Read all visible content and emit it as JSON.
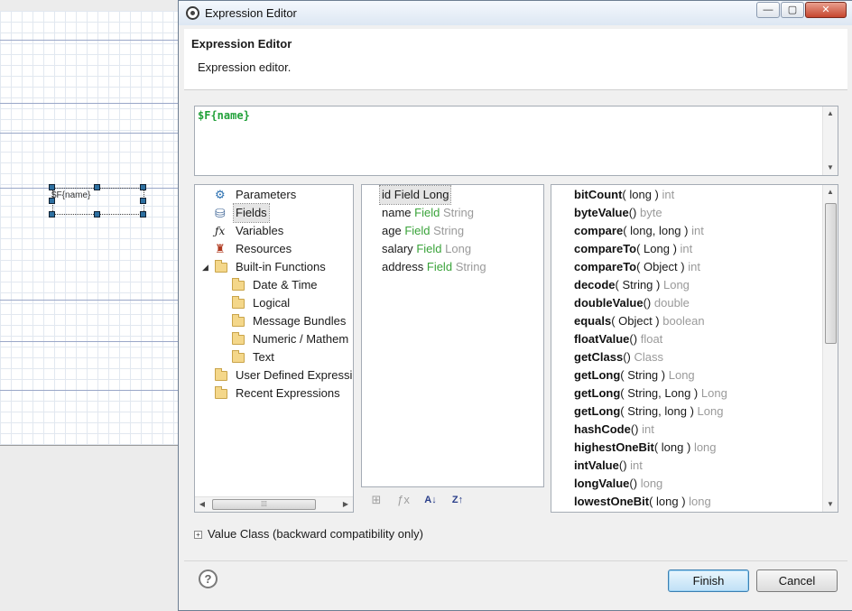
{
  "background_canvas": {
    "field_label": "$F{name}"
  },
  "dialog": {
    "window_title": "Expression Editor",
    "window_buttons": {
      "minimize": "—",
      "maximize": "▢",
      "close": "✕"
    },
    "header_title": "Expression Editor",
    "header_description": "Expression editor.",
    "expression_text": "$F{name}"
  },
  "categories": [
    {
      "label": "Parameters",
      "icon": "parameters-icon",
      "level": 0
    },
    {
      "label": "Fields",
      "icon": "fields-icon",
      "level": 0,
      "selected": true
    },
    {
      "label": "Variables",
      "icon": "variables-icon",
      "level": 0
    },
    {
      "label": "Resources",
      "icon": "resources-icon",
      "level": 0
    },
    {
      "label": "Built-in Functions",
      "icon": "folder-icon",
      "level": 0,
      "expanded": true
    },
    {
      "label": "Date & Time",
      "icon": "folder-icon",
      "level": 1
    },
    {
      "label": "Logical",
      "icon": "folder-icon",
      "level": 1
    },
    {
      "label": "Message Bundles",
      "icon": "folder-icon",
      "level": 1
    },
    {
      "label": "Numeric / Mathem",
      "icon": "folder-icon",
      "level": 1
    },
    {
      "label": "Text",
      "icon": "folder-icon",
      "level": 1
    },
    {
      "label": "User Defined Expressi",
      "icon": "folder-icon",
      "level": 0
    },
    {
      "label": "Recent Expressions",
      "icon": "folder-icon",
      "level": 0
    }
  ],
  "fields": [
    {
      "name": "id",
      "kind": "Field",
      "type": "Long",
      "selected": true
    },
    {
      "name": "name",
      "kind": "Field",
      "type": "String"
    },
    {
      "name": "age",
      "kind": "Field",
      "type": "String"
    },
    {
      "name": "salary",
      "kind": "Field",
      "type": "Long"
    },
    {
      "name": "address",
      "kind": "Field",
      "type": "String"
    }
  ],
  "methods": [
    {
      "name": "bitCount",
      "params": "( long )",
      "ret": "int"
    },
    {
      "name": "byteValue",
      "params": "()",
      "ret": "byte"
    },
    {
      "name": "compare",
      "params": "( long, long )",
      "ret": "int"
    },
    {
      "name": "compareTo",
      "params": "( Long )",
      "ret": "int"
    },
    {
      "name": "compareTo",
      "params": "( Object )",
      "ret": "int"
    },
    {
      "name": "decode",
      "params": "( String )",
      "ret": "Long"
    },
    {
      "name": "doubleValue",
      "params": "()",
      "ret": "double"
    },
    {
      "name": "equals",
      "params": "( Object )",
      "ret": "boolean"
    },
    {
      "name": "floatValue",
      "params": "()",
      "ret": "float"
    },
    {
      "name": "getClass",
      "params": "()",
      "ret": "Class"
    },
    {
      "name": "getLong",
      "params": "( String )",
      "ret": "Long"
    },
    {
      "name": "getLong",
      "params": "( String, Long )",
      "ret": "Long"
    },
    {
      "name": "getLong",
      "params": "( String, long )",
      "ret": "Long"
    },
    {
      "name": "hashCode",
      "params": "()",
      "ret": "int"
    },
    {
      "name": "highestOneBit",
      "params": "( long )",
      "ret": "long"
    },
    {
      "name": "intValue",
      "params": "()",
      "ret": "int"
    },
    {
      "name": "longValue",
      "params": "()",
      "ret": "long"
    },
    {
      "name": "lowestOneBit",
      "params": "( long )",
      "ret": "long"
    }
  ],
  "field_tools": [
    {
      "name": "add-field-tool-icon",
      "glyph": "⊞"
    },
    {
      "name": "function-tool-icon",
      "glyph": "ƒx"
    },
    {
      "name": "sort-ascending-icon",
      "glyph": "A↓"
    },
    {
      "name": "sort-descending-icon",
      "glyph": "Z↑"
    }
  ],
  "value_class_label": "Value Class (backward compatibility only)",
  "footer": {
    "help_glyph": "?",
    "finish_label": "Finish",
    "cancel_label": "Cancel"
  },
  "colors": {
    "keyword_green": "#3aa33a",
    "type_gray": "#9a9a9a",
    "expression_green": "#22a13a"
  }
}
